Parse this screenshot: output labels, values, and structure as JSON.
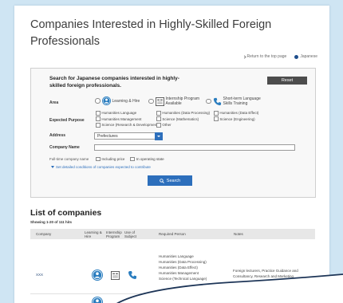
{
  "page": {
    "title": "Companies Interested in Highly-Skilled Foreign Professionals"
  },
  "header_links": {
    "back": "Return to the top page",
    "language": "Japanese"
  },
  "search": {
    "heading": "Search for Japanese companies interested in highly-skilled foreign professionals.",
    "reset_label": "Reset",
    "area": {
      "label": "Area",
      "options": [
        {
          "label": "Learning & Hire",
          "icon": "graduate-icon"
        },
        {
          "label": "Internship Program Available",
          "icon": "internship-icon"
        },
        {
          "label": "Short-term Language Skills Training",
          "icon": "language-icon"
        }
      ]
    },
    "purpose": {
      "label": "Expected Purpose",
      "options": [
        "Humanities Language",
        "Humanities (Data Processing)",
        "Humanities (Data Effect)",
        "Humanities Management",
        "Science (Mathematics)",
        "Science (Engineering)",
        "Science (Research & Development)",
        "Other"
      ]
    },
    "address": {
      "label": "Address",
      "value": "Prefectures"
    },
    "company_name": {
      "label": "Company Name"
    },
    "hiring": {
      "label": "Full-time company name",
      "options": [
        "Including price",
        "In operating state"
      ]
    },
    "detail_link": "Set detailed conditions of companies expected to contribute",
    "search_label": "Search"
  },
  "list": {
    "heading": "List of companies",
    "count": "Showing 1-20 of 111 hits",
    "columns": [
      "Company",
      "Learning & Hire",
      "Internship Program",
      "Use of Subject",
      "Required Person",
      "Notes"
    ],
    "rows": [
      {
        "company": "XXX",
        "learning_hire": true,
        "internship": true,
        "use_of_subject": true,
        "required_person": [
          "Humanities Language",
          "Humanities (Data Processing)",
          "Humanities (Data Effect)",
          "Humanities Management",
          "Science (Technical Language)"
        ],
        "notes": "Foreign lecturers, Practice Guidance and Consultancy, Research and Marketing"
      },
      {
        "learning_hire": true
      }
    ]
  },
  "colors": {
    "frame": "#cfe5f3",
    "accent": "#2d6fbc",
    "icon_blue": "#2a7dbf",
    "overlay_stroke": "#1d3557"
  }
}
